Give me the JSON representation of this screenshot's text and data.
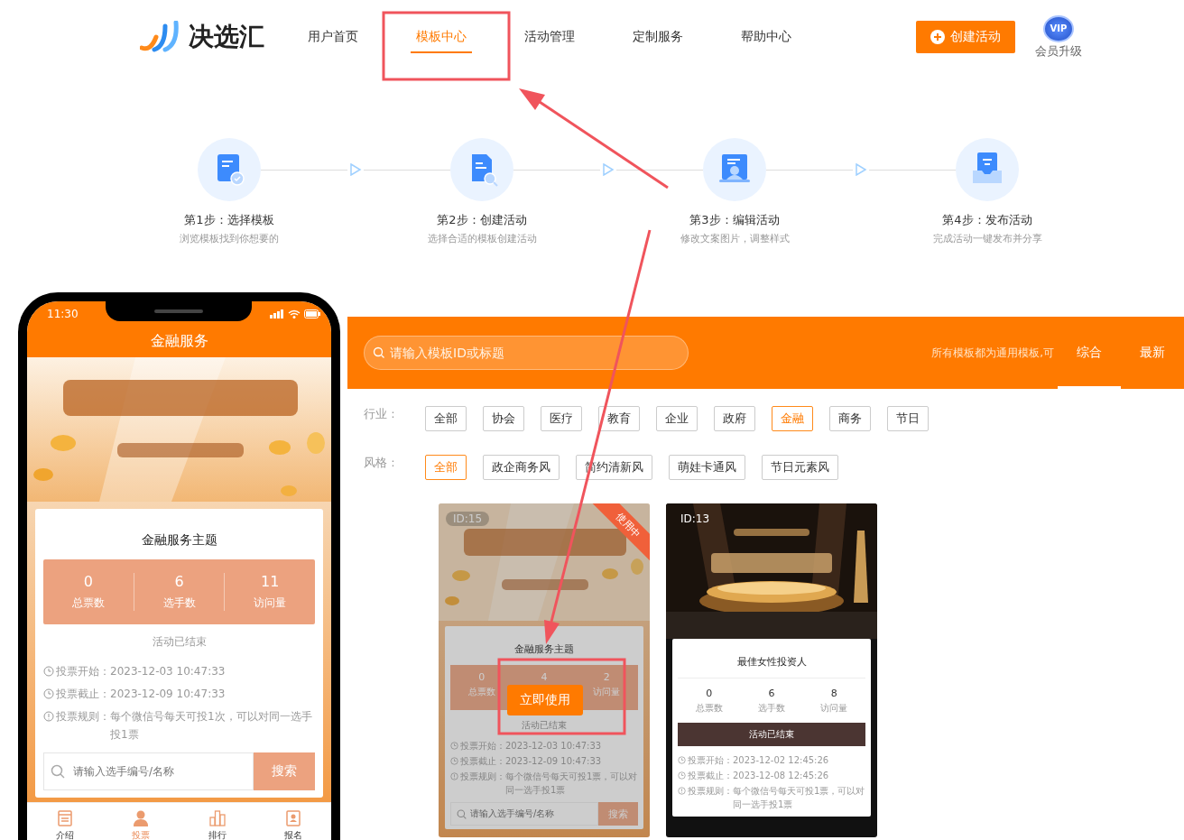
{
  "header": {
    "logo": "决选汇",
    "nav": [
      {
        "label": "用户首页",
        "selected": false
      },
      {
        "label": "模板中心",
        "selected": true
      },
      {
        "label": "活动管理",
        "selected": false
      },
      {
        "label": "定制服务",
        "selected": false
      },
      {
        "label": "帮助中心",
        "selected": false
      }
    ],
    "create_button": "创建活动",
    "vip": {
      "badge": "VIP",
      "label": "会员升级"
    }
  },
  "steps": [
    {
      "kind": "select",
      "title": "第1步：选择模板",
      "desc": "浏览模板找到你想要的"
    },
    {
      "kind": "create",
      "title": "第2步：创建活动",
      "desc": "选择合适的模板创建活动"
    },
    {
      "kind": "edit",
      "title": "第3步：编辑活动",
      "desc": "修改文案图片，调整样式"
    },
    {
      "kind": "publish",
      "title": "第4步：发布活动",
      "desc": "完成活动一键发布并分享"
    }
  ],
  "phone": {
    "time": "11:30",
    "title": "金融服务",
    "theme_title": "金融服务主题",
    "stats": [
      {
        "value": "0",
        "label": "总票数"
      },
      {
        "value": "6",
        "label": "选手数"
      },
      {
        "value": "11",
        "label": "访问量"
      }
    ],
    "status": "活动已结束",
    "info": [
      {
        "kind": "clock",
        "label": "投票开始：",
        "value": "2023-12-03 10:47:33"
      },
      {
        "kind": "clock",
        "label": "投票截止：",
        "value": "2023-12-09 10:47:33"
      },
      {
        "kind": "info",
        "label": "投票规则：",
        "value": "每个微信号每天可投1次，可以对同一选手投1票"
      }
    ],
    "search": {
      "placeholder": "请输入选手编号/名称",
      "button": "搜索"
    },
    "tabs": [
      {
        "kind": "intro",
        "label": "介绍",
        "selected": false
      },
      {
        "kind": "vote",
        "label": "投票",
        "selected": true
      },
      {
        "kind": "rank",
        "label": "排行",
        "selected": false
      },
      {
        "kind": "signup",
        "label": "报名",
        "selected": false
      }
    ]
  },
  "templates": {
    "search": {
      "placeholder": "请输入模板ID或标题"
    },
    "notice": "所有模板都为通用模板,可",
    "sorts": [
      {
        "label": "综合",
        "selected": true
      },
      {
        "label": "最新",
        "selected": false
      }
    ],
    "filters": [
      {
        "label": "行业 :",
        "options": [
          {
            "label": "全部",
            "selected": false
          },
          {
            "label": "协会",
            "selected": false
          },
          {
            "label": "医疗",
            "selected": false
          },
          {
            "label": "教育",
            "selected": false
          },
          {
            "label": "企业",
            "selected": false
          },
          {
            "label": "政府",
            "selected": false
          },
          {
            "label": "金融",
            "selected": true
          },
          {
            "label": "商务",
            "selected": false
          },
          {
            "label": "节日",
            "selected": false
          }
        ]
      },
      {
        "label": "风格 :",
        "options": [
          {
            "label": "全部",
            "selected": true
          },
          {
            "label": "政企商务风",
            "selected": false
          },
          {
            "label": "简约清新风",
            "selected": false
          },
          {
            "label": "萌娃卡通风",
            "selected": false
          },
          {
            "label": "节日元素风",
            "selected": false
          }
        ]
      }
    ],
    "cards": [
      {
        "id": "ID:15",
        "kind": "warm",
        "in_use": true,
        "ribbon": "使用中",
        "hovered": true,
        "use_button": "立即使用",
        "title": "金融服务主题",
        "stats": [
          {
            "value": "0",
            "label": "总票数"
          },
          {
            "value": "4"
          },
          {
            "value": "2",
            "label": "访问量"
          }
        ],
        "status": "活动已结束",
        "info": [
          {
            "kind": "clock",
            "label": "投票开始：",
            "value": "2023-12-03 10:47:33"
          },
          {
            "kind": "clock",
            "label": "投票截止：",
            "value": "2023-12-09 10:47:33"
          },
          {
            "kind": "info",
            "label": "投票规则：",
            "value": "每个微信号每天可投1票，可以对同一选手投1票"
          }
        ],
        "search": {
          "placeholder": "请输入选手编号/名称",
          "button": "搜索"
        }
      },
      {
        "id": "ID:13",
        "kind": "dark",
        "in_use": false,
        "hovered": false,
        "title": "最佳女性投资人",
        "stats": [
          {
            "value": "0",
            "label": "总票数"
          },
          {
            "value": "6",
            "label": "选手数"
          },
          {
            "value": "8",
            "label": "访问量"
          }
        ],
        "status": "活动已结束",
        "info": [
          {
            "kind": "clock",
            "label": "投票开始：",
            "value": "2023-12-02 12:45:26"
          },
          {
            "kind": "clock",
            "label": "投票截止：",
            "value": "2023-12-08 12:45:26"
          },
          {
            "kind": "info",
            "label": "投票规则：",
            "value": "每个微信号每天可投1票，可以对同一选手投1票"
          }
        ]
      }
    ]
  }
}
